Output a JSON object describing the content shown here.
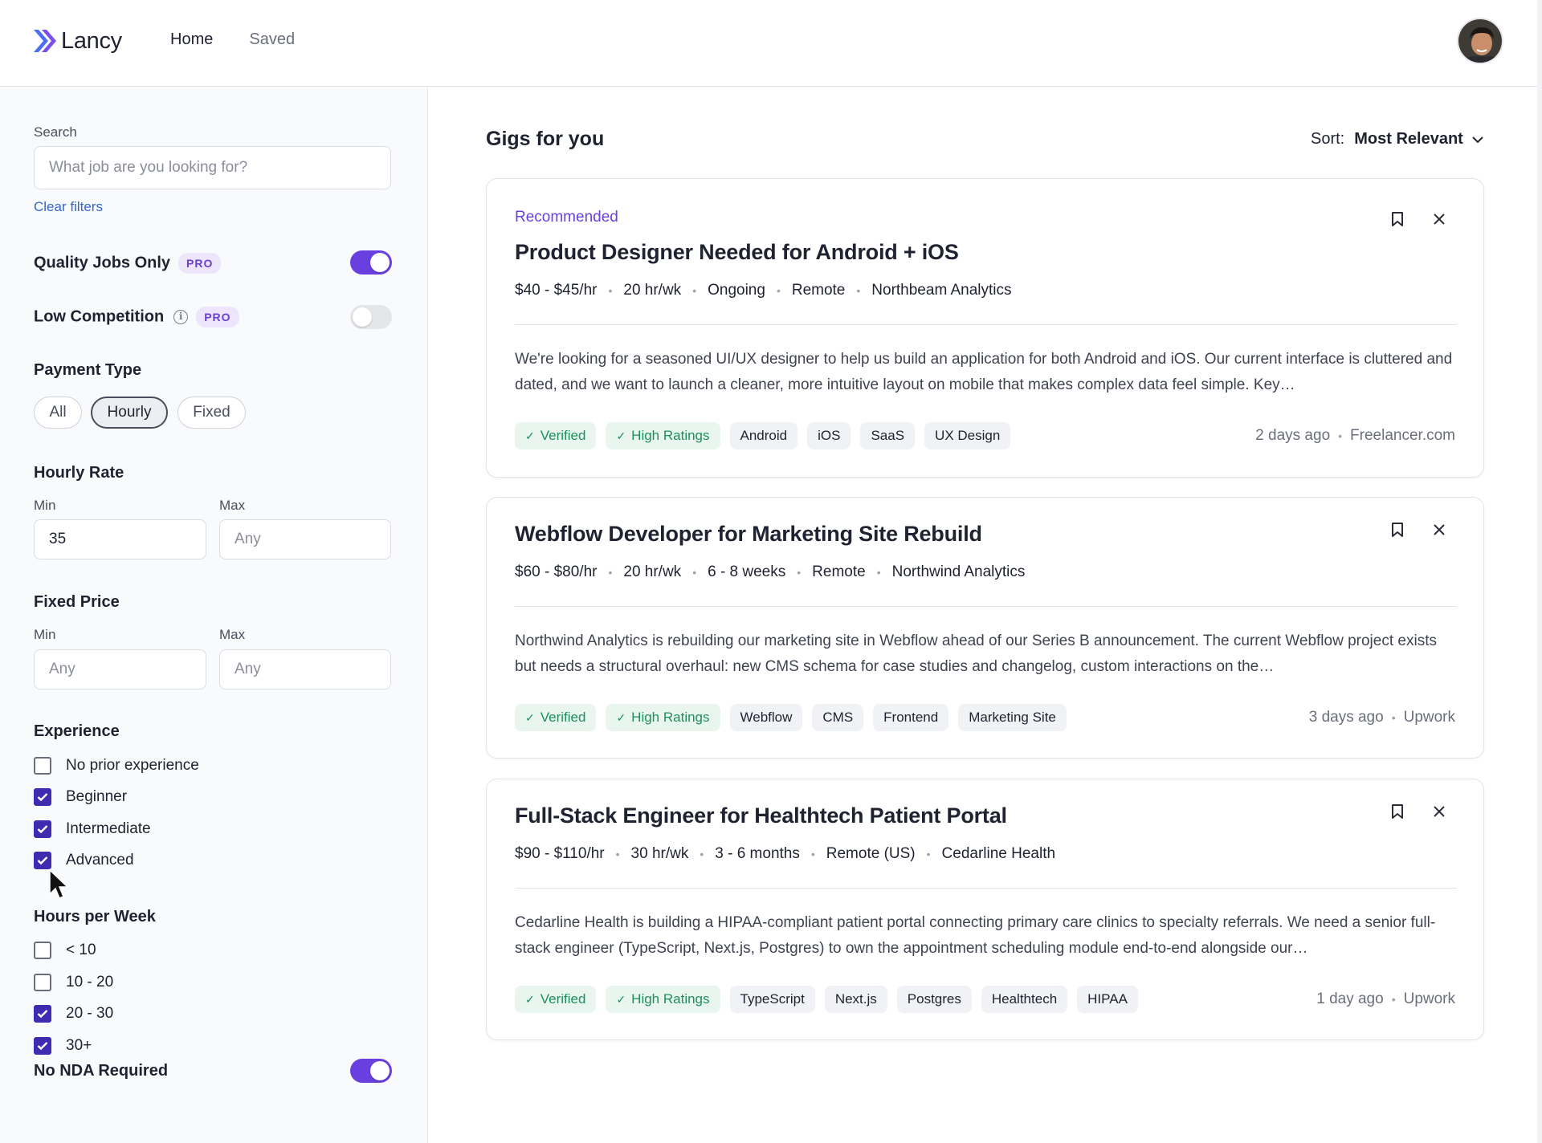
{
  "app": {
    "name": "Lancy"
  },
  "nav": {
    "home": "Home",
    "saved": "Saved"
  },
  "user": {
    "avatar": "avatar"
  },
  "sidebar": {
    "search_label": "Search",
    "search_placeholder": "What job are you looking for?",
    "clear_filters": "Clear filters",
    "quality_jobs": {
      "label": "Quality Jobs Only",
      "badge": "PRO",
      "enabled": true
    },
    "low_competition": {
      "label": "Low Competition",
      "badge": "PRO",
      "enabled": false
    },
    "payment_type": {
      "label": "Payment Type",
      "options": [
        "All",
        "Hourly",
        "Fixed"
      ],
      "selected": "Hourly"
    },
    "hourly_rate": {
      "label": "Hourly Rate",
      "min_label": "Min",
      "max_label": "Max",
      "min_value": "35",
      "max_value": "Any"
    },
    "fixed_price": {
      "label": "Fixed Price",
      "min_label": "Min",
      "max_label": "Max",
      "min_value": "Any",
      "max_value": "Any"
    },
    "experience": {
      "label": "Experience",
      "items": [
        {
          "label": "No prior experience",
          "checked": false
        },
        {
          "label": "Beginner",
          "checked": true
        },
        {
          "label": "Intermediate",
          "checked": true
        },
        {
          "label": "Advanced",
          "checked": true
        }
      ]
    },
    "hours_per_week": {
      "label": "Hours per Week",
      "items": [
        {
          "label": "< 10",
          "checked": false
        },
        {
          "label": "10 - 20",
          "checked": false
        },
        {
          "label": "20 - 30",
          "checked": true
        },
        {
          "label": "30+",
          "checked": true
        }
      ]
    },
    "no_nda": {
      "label": "No NDA Required",
      "enabled": true
    }
  },
  "main": {
    "title": "Gigs for you",
    "sort_label": "Sort:",
    "sort_value": "Most Relevant",
    "gigs": [
      {
        "recommended": "Recommended",
        "title": "Product Designer Needed for Android + iOS",
        "meta": [
          "$40 - $45/hr",
          "20 hr/wk",
          "Ongoing",
          "Remote",
          "Northbeam Analytics"
        ],
        "description": "We're looking for a seasoned UI/UX designer to help us build an application for both Android and iOS. Our current interface is cluttered and dated, and we want to launch a cleaner, more intuitive layout on mobile that makes complex data feel simple. Key…",
        "badges": [
          "Verified",
          "High Ratings"
        ],
        "tags": [
          "Android",
          "iOS",
          "SaaS",
          "UX Design"
        ],
        "posted": "2 days ago",
        "source": "Freelancer.com"
      },
      {
        "recommended": "",
        "title": "Webflow Developer for Marketing Site Rebuild",
        "meta": [
          "$60 - $80/hr",
          "20 hr/wk",
          "6 - 8 weeks",
          "Remote",
          "Northwind Analytics"
        ],
        "description": "Northwind Analytics is rebuilding our marketing site in Webflow ahead of our Series B announcement. The current Webflow project exists but needs a structural overhaul: new CMS schema for case studies and changelog, custom interactions on the…",
        "badges": [
          "Verified",
          "High Ratings"
        ],
        "tags": [
          "Webflow",
          "CMS",
          "Frontend",
          "Marketing Site"
        ],
        "posted": "3 days ago",
        "source": "Upwork"
      },
      {
        "recommended": "",
        "title": "Full-Stack Engineer for Healthtech Patient Portal",
        "meta": [
          "$90 - $110/hr",
          "30 hr/wk",
          "3 - 6 months",
          "Remote (US)",
          "Cedarline Health"
        ],
        "description": "Cedarline Health is building a HIPAA-compliant patient portal connecting primary care clinics to specialty referrals. We need a senior full-stack engineer (TypeScript, Next.js, Postgres) to own the appointment scheduling module end-to-end alongside our…",
        "badges": [
          "Verified",
          "High Ratings"
        ],
        "tags": [
          "TypeScript",
          "Next.js",
          "Postgres",
          "Healthtech",
          "HIPAA"
        ],
        "posted": "1 day ago",
        "source": "Upwork"
      }
    ]
  },
  "colors": {
    "accent": "#6a3fe0",
    "checkbox": "#3f2bb0",
    "verified": "#1e8f5a",
    "link": "#3267c9"
  }
}
